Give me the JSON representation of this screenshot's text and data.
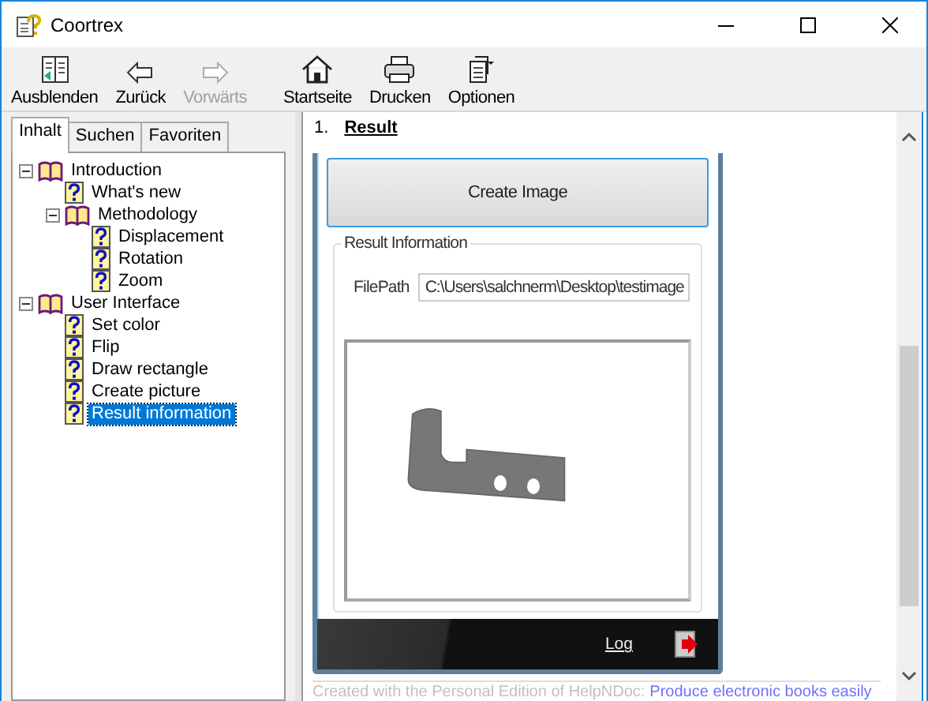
{
  "window": {
    "title": "Coortrex"
  },
  "toolbar": [
    {
      "label": "Ausblenden",
      "kind": "hide",
      "disabled": false
    },
    {
      "label": "Zurück",
      "kind": "back",
      "disabled": false
    },
    {
      "label": "Vorwärts",
      "kind": "forward",
      "disabled": true
    },
    {
      "label": "Startseite",
      "kind": "home",
      "disabled": false
    },
    {
      "label": "Drucken",
      "kind": "print",
      "disabled": false
    },
    {
      "label": "Optionen",
      "kind": "options",
      "disabled": false
    }
  ],
  "tabs": [
    {
      "label": "Inhalt",
      "selected": true
    },
    {
      "label": "Suchen",
      "selected": false
    },
    {
      "label": "Favoriten",
      "selected": false
    }
  ],
  "tree": [
    {
      "label": "Introduction",
      "kind": "book",
      "expanded": true,
      "selected": false,
      "children": [
        {
          "label": "What's new",
          "kind": "page",
          "selected": false
        },
        {
          "label": "Methodology",
          "kind": "book",
          "expanded": true,
          "selected": false,
          "children": [
            {
              "label": "Displacement",
              "kind": "page",
              "selected": false
            },
            {
              "label": "Rotation",
              "kind": "page",
              "selected": false
            },
            {
              "label": "Zoom",
              "kind": "page",
              "selected": false
            }
          ]
        }
      ]
    },
    {
      "label": "User Interface",
      "kind": "book",
      "expanded": true,
      "selected": false,
      "children": [
        {
          "label": "Set color",
          "kind": "page",
          "selected": false
        },
        {
          "label": "Flip",
          "kind": "page",
          "selected": false
        },
        {
          "label": "Draw rectangle",
          "kind": "page",
          "selected": false
        },
        {
          "label": "Create picture",
          "kind": "page",
          "selected": false
        },
        {
          "label": "Result information",
          "kind": "page",
          "selected": true
        }
      ]
    }
  ],
  "content": {
    "number": "1.",
    "heading": "Result",
    "app": {
      "button": "Create Image",
      "group_title": "Result Information",
      "field_label": "FilePath",
      "field_value": "C:\\Users\\salchnerm\\Desktop\\testimage",
      "link": "Log"
    },
    "footer": {
      "text": "Created with the Personal Edition of HelpNDoc:",
      "link": "Produce electronic books easily"
    }
  }
}
